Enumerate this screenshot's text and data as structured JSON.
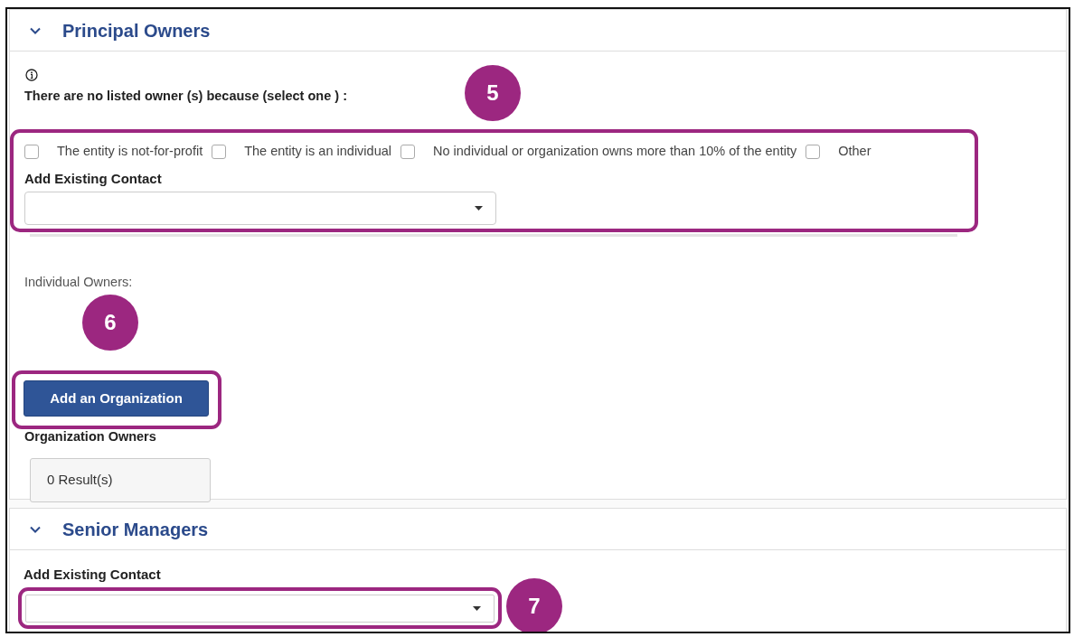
{
  "principal_owners": {
    "title": "Principal Owners",
    "expanded": true,
    "prompt": "There are no listed owner (s) because (select one ) :",
    "options": [
      {
        "label": "The entity is not-for-profit",
        "checked": false
      },
      {
        "label": "The entity is an individual",
        "checked": false
      },
      {
        "label": "No individual or organization owns more than 10% of the entity",
        "checked": false
      },
      {
        "label": "Other",
        "checked": false
      }
    ],
    "contact_label": "Add Existing Contact",
    "individual_owners_label": "Individual Owners:",
    "add_button": "Add an Organization",
    "organization_owners_label": "Organization Owners",
    "results": "0 Result(s)"
  },
  "senior_managers": {
    "title": "Senior Managers",
    "expanded": true,
    "contact_label": "Add Existing Contact"
  },
  "callouts": [
    "5",
    "6",
    "7"
  ]
}
